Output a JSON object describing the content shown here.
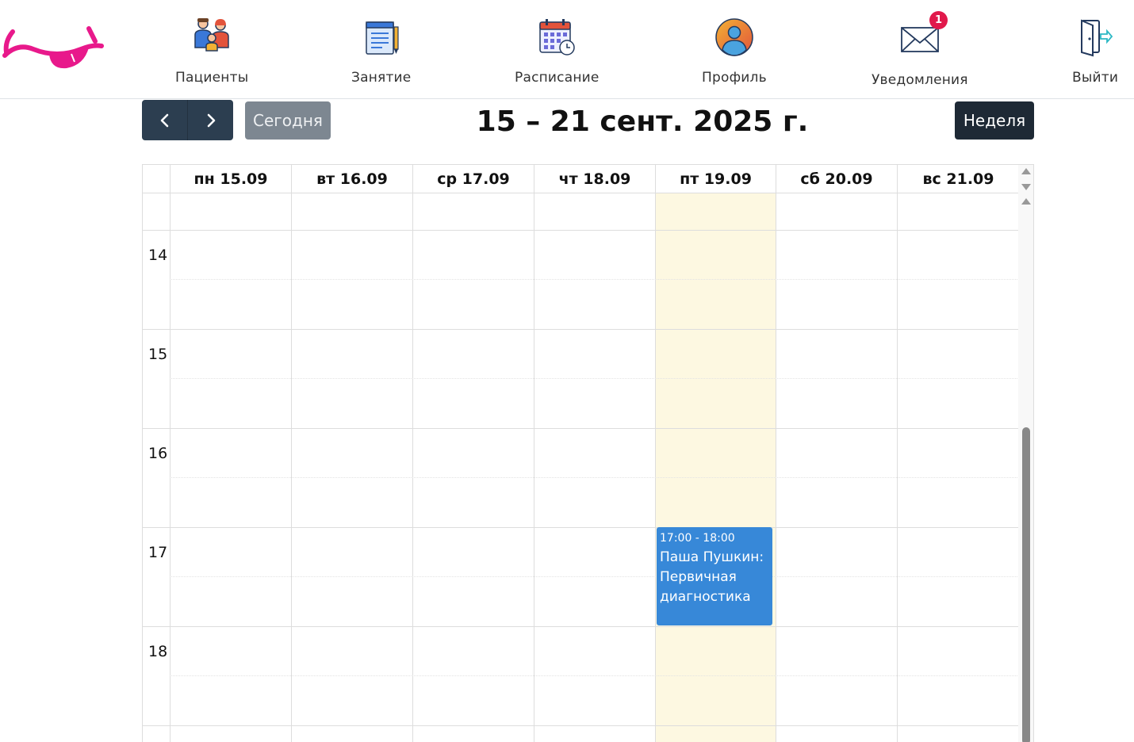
{
  "nav": {
    "patients": "Пациенты",
    "session": "Занятие",
    "schedule": "Расписание",
    "profile": "Профиль",
    "notifications": "Уведомления",
    "notifications_count": "1",
    "logout": "Выйти"
  },
  "toolbar": {
    "prev_icon": "chevron-left-icon",
    "next_icon": "chevron-right-icon",
    "today": "Сегодня",
    "title": "15 – 21 сент. 2025 г.",
    "view": "Неделя"
  },
  "calendar": {
    "days": [
      "пн 15.09",
      "вт 16.09",
      "ср 17.09",
      "чт 18.09",
      "пт 19.09",
      "сб 20.09",
      "вс 21.09"
    ],
    "today_index": 4,
    "hours": [
      "14",
      "15",
      "16",
      "17",
      "18"
    ],
    "event": {
      "time": "17:00 - 18:00",
      "title": "Паша Пушкин: Первичная диагностика",
      "day_index": 4,
      "color": "#3788d8"
    }
  },
  "colors": {
    "logo": "#e8198b",
    "today_bg": "#fdf8e1",
    "nav_button": "#2c3e50",
    "badge": "#e1194b"
  }
}
